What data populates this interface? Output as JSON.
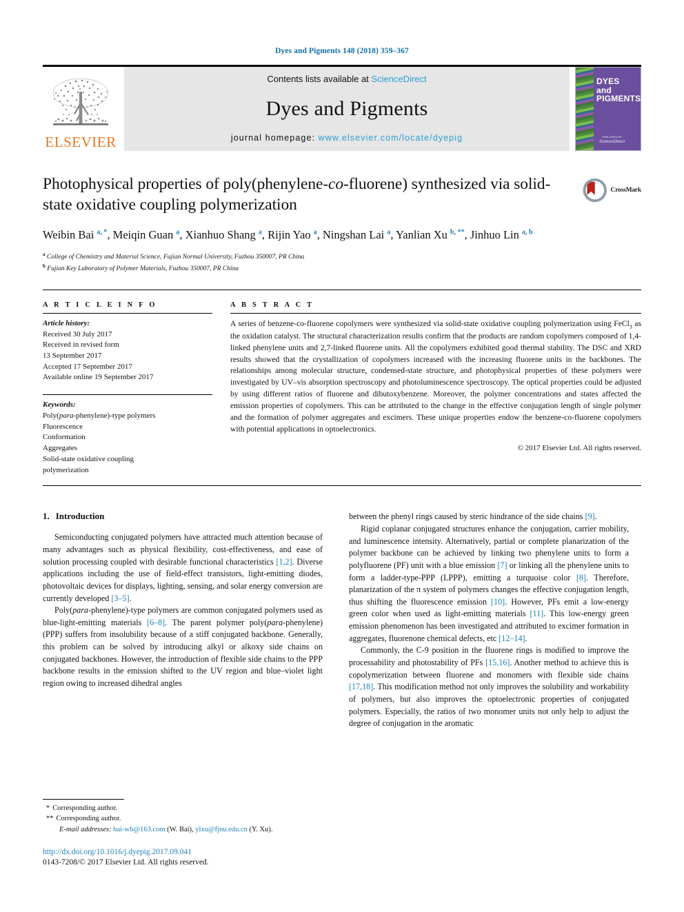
{
  "running_head": "Dyes and Pigments 148 (2018) 359–367",
  "masthead": {
    "publisher_name": "ELSEVIER",
    "contents_prefix": "Contents lists available at ",
    "contents_link": "ScienceDirect",
    "journal_title": "Dyes and Pigments",
    "homepage_prefix": "journal homepage: ",
    "homepage_url": "www.elsevier.com/locate/dyepig",
    "cover": {
      "line1": "DYES",
      "line2": "and",
      "line3": "PIGMENTS",
      "foot_small": "PUBLISHED BY",
      "foot_big": "ScienceDirect"
    }
  },
  "article": {
    "title_line1_a": "Photophysical properties of poly(phenylene-",
    "title_line1_co": "co",
    "title_line1_b": "-fluorene) synthesized",
    "title_line2": "via solid-state oxidative coupling polymerization",
    "crossmark_label": "CrossMark",
    "authors": [
      {
        "name": "Weibin Bai",
        "sup": "a, *",
        "sep": ", "
      },
      {
        "name": "Meiqin Guan",
        "sup": "a",
        "sep": ", "
      },
      {
        "name": "Xianhuo Shang",
        "sup": "a",
        "sep": ", "
      },
      {
        "name": "Rijin Yao",
        "sup": "a",
        "sep": ", "
      },
      {
        "name": "Ningshan Lai",
        "sup": "a",
        "sep": ", "
      },
      {
        "name": "Yanlian Xu",
        "sup": "b, **",
        "sep": ", "
      },
      {
        "name": "Jinhuo Lin",
        "sup": "a, b",
        "sep": ""
      }
    ],
    "affiliations": [
      {
        "marker": "a",
        "text": "College of Chemistry and Material Science, Fujian Normal University, Fuzhou 350007, PR China"
      },
      {
        "marker": "b",
        "text": "Fujian Key Laboratory of Polymer Materials, Fuzhou 350007, PR China"
      }
    ]
  },
  "article_info": {
    "heading": "A R T I C L E   I N F O",
    "history_label": "Article history:",
    "history": [
      "Received 30 July 2017",
      "Received in revised form",
      "13 September 2017",
      "Accepted 17 September 2017",
      "Available online 19 September 2017"
    ],
    "keywords_label": "Keywords:",
    "keywords": [
      "Poly(para-phenylene)-type polymers",
      "Fluorescence",
      "Conformation",
      "Aggregates",
      "Solid-state oxidative coupling",
      "polymerization"
    ],
    "keyword_italic_part": "para"
  },
  "abstract": {
    "heading": "A B S T R A C T",
    "text_part1": "A series of benzene-co-fluorene copolymers were synthesized via solid-state oxidative coupling polymerization using FeCl",
    "formula_sub": "3",
    "text_part2": " as the oxidation catalyst. The structural characterization results confirm that the products are random copolymers composed of 1,4-linked phenylene units and 2,7-linked fluorene units. All the copolymers exhibited good thermal stability. The DSC and XRD results showed that the crystallization of copolymers increased with the increasing fluorene units in the backbones. The relationships among molecular structure, condensed-state structure, and photophysical properties of these polymers were investigated by UV–vis absorption spectroscopy and photoluminescence spectroscopy. The optical properties could be adjusted by using different ratios of fluorene and dibutoxybenzene. Moreover, the polymer concentrations and states affected the emission properties of copolymers. This can be attributed to the change in the effective conjugation length of single polymer and the formation of polymer aggregates and excimers. These unique properties endow the benzene-co-fluorene copolymers with potential applications in optoelectronics.",
    "copyright": "© 2017 Elsevier Ltd. All rights reserved."
  },
  "body": {
    "section_number": "1.",
    "section_title": "Introduction",
    "left_paragraphs": [
      {
        "segments": [
          {
            "t": "Semiconducting conjugated polymers have attracted much attention because of many advantages such as physical flexibility, cost-effectiveness, and ease of solution processing coupled with desirable functional characteristics "
          },
          {
            "t": "[1,2]",
            "k": "ref"
          },
          {
            "t": ". Diverse applications including the use of field-effect transistors, light-emitting diodes, photovoltaic devices for displays, lighting, sensing, and solar energy conversion are currently developed "
          },
          {
            "t": "[3–5]",
            "k": "ref"
          },
          {
            "t": "."
          }
        ]
      },
      {
        "segments": [
          {
            "t": "Poly("
          },
          {
            "t": "para",
            "k": "ital"
          },
          {
            "t": "-phenylene)-type polymers are common conjugated polymers used as blue-light-emitting materials "
          },
          {
            "t": "[6–8]",
            "k": "ref"
          },
          {
            "t": ". The parent polymer poly("
          },
          {
            "t": "para",
            "k": "ital"
          },
          {
            "t": "-phenylene) (PPP) suffers from insolubility because of a stiff conjugated backbone. Generally, this problem can be solved by introducing alkyl or alkoxy side chains on conjugated backbones. However, the introduction of flexible side chains to the PPP backbone results in the emission shifted to the UV region and blue–violet light region owing to increased dihedral angles"
          }
        ]
      }
    ],
    "right_paragraphs": [
      {
        "no_indent": true,
        "segments": [
          {
            "t": "between the phenyl rings caused by steric hindrance of the side chains "
          },
          {
            "t": "[9]",
            "k": "ref"
          },
          {
            "t": "."
          }
        ]
      },
      {
        "segments": [
          {
            "t": "Rigid coplanar conjugated structures enhance the conjugation, carrier mobility, and luminescence intensity. Alternatively, partial or complete planarization of the polymer backbone can be achieved by linking two phenylene units to form a polyfluorene (PF) unit with a blue emission "
          },
          {
            "t": "[7]",
            "k": "ref"
          },
          {
            "t": " or linking all the phenylene units to form a ladder-type-PPP (LPPP), emitting a turquoise color "
          },
          {
            "t": "[8]",
            "k": "ref"
          },
          {
            "t": ". Therefore, planarization of the π system of polymers changes the effective conjugation length, thus shifting the fluorescence emission "
          },
          {
            "t": "[10]",
            "k": "ref"
          },
          {
            "t": ". However, PFs emit a low-energy green color when used as light-emitting materials "
          },
          {
            "t": "[11]",
            "k": "ref"
          },
          {
            "t": ". This low-energy green emission phenomenon has been investigated and attributed to excimer formation in aggregates, fluorenone chemical defects, etc "
          },
          {
            "t": "[12–14]",
            "k": "ref"
          },
          {
            "t": "."
          }
        ]
      },
      {
        "segments": [
          {
            "t": "Commonly, the C-9 position in the fluorene rings is modified to improve the processability and photostability of PFs "
          },
          {
            "t": "[15,16]",
            "k": "ref"
          },
          {
            "t": ". Another method to achieve this is copolymerization between fluorene and monomers with flexible side chains "
          },
          {
            "t": "[17,18]",
            "k": "ref"
          },
          {
            "t": ". This modification method not only improves the solubility and workability of polymers, but also improves the optoelectronic properties of conjugated polymers. Especially, the ratios of two monomer units not only help to adjust the degree of conjugation in the aromatic"
          }
        ]
      }
    ]
  },
  "footnotes": {
    "corresponding_1_star": "*",
    "corresponding_1": "Corresponding author.",
    "corresponding_2_star": "**",
    "corresponding_2": "Corresponding author.",
    "email_label": "E-mail addresses:",
    "email_1": "bai-wb@163.com",
    "email_1_owner": "(W. Bai)",
    "email_2": "ylxu@fjnu.edu.cn",
    "email_2_owner": "(Y. Xu)",
    "doi": "http://dx.doi.org/10.1016/j.dyepig.2017.09.041",
    "issn": "0143-7208/© 2017 Elsevier Ltd. All rights reserved."
  },
  "colors": {
    "link_blue": "#1f7fb5",
    "sciencedirect_blue": "#2b9fd4",
    "elsevier_orange": "#E87722",
    "cover_purple": "#6b4f9e",
    "band_gray": "#e6e6e6"
  }
}
